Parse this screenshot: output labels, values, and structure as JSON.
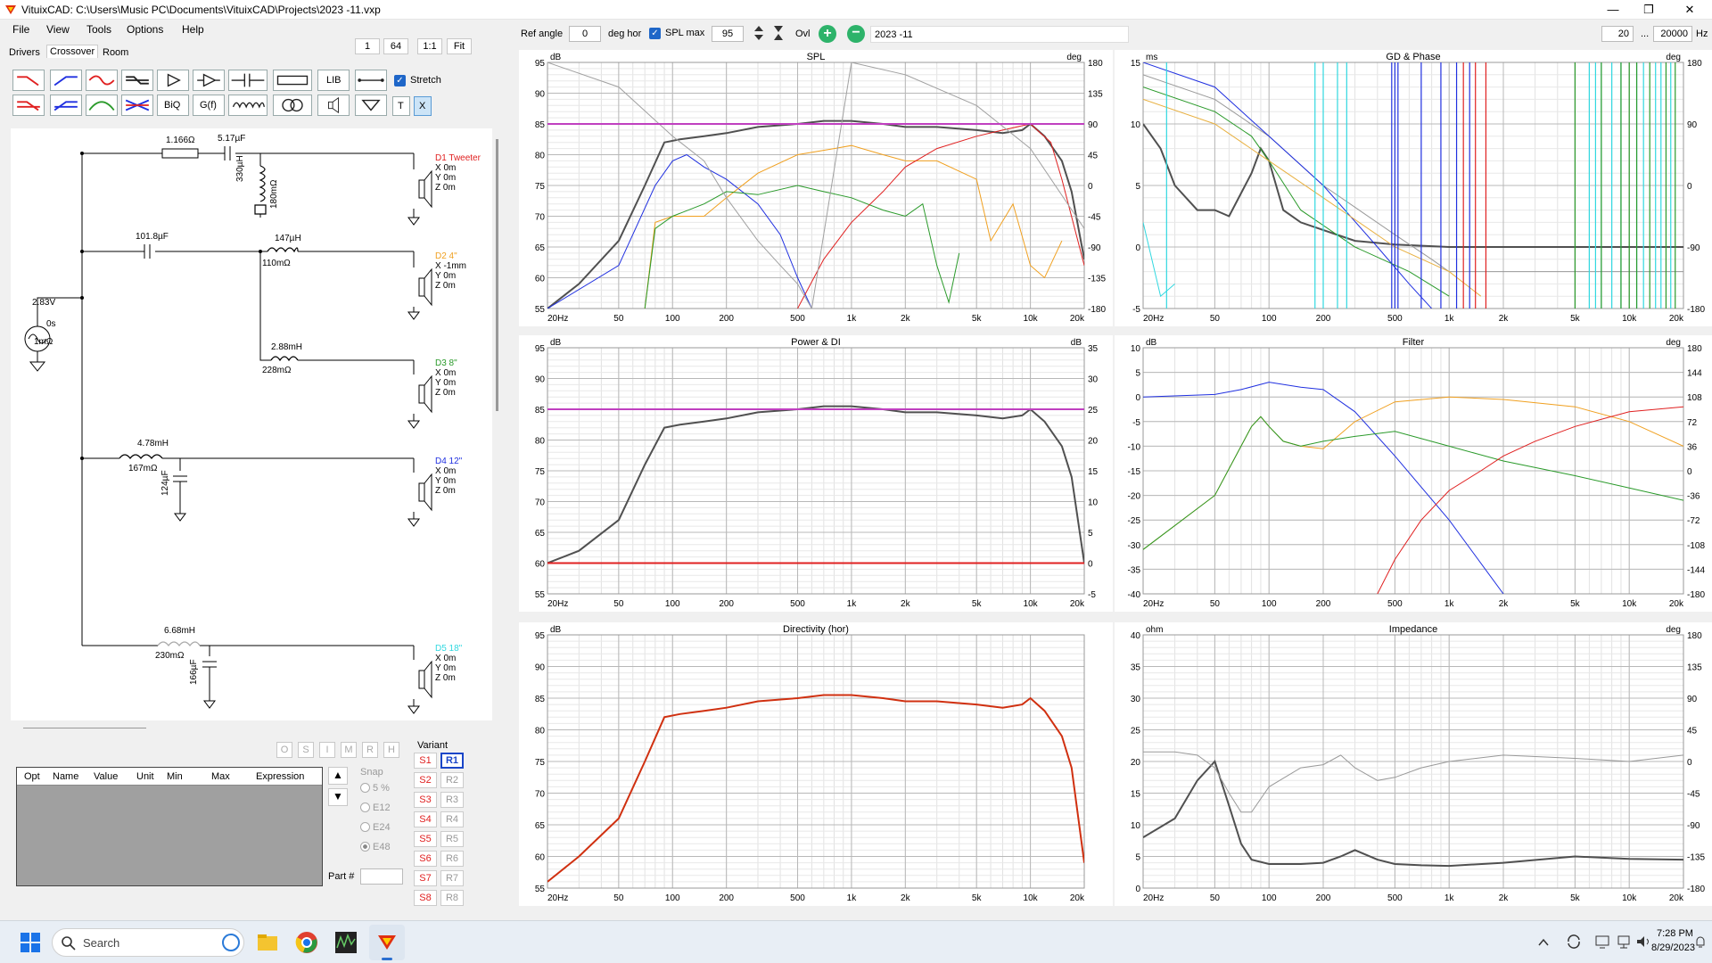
{
  "window": {
    "title": "VituixCAD: C:\\Users\\Music PC\\Documents\\VituixCAD\\Projects\\2023 -11.vxp",
    "minimize": "—",
    "maximize": "❐",
    "close": "✕"
  },
  "menu": [
    "File",
    "View",
    "Tools",
    "Options",
    "Help"
  ],
  "tabs": [
    "Drivers",
    "Crossover",
    "Room"
  ],
  "zoom_buttons": [
    "1",
    "64",
    "1:1",
    "Fit"
  ],
  "toolbar": {
    "lib": "LIB",
    "biq": "BiQ",
    "gf": "G(f)",
    "t": "T",
    "x": "X",
    "stretch": "Stretch"
  },
  "top": {
    "ref_angle_label": "Ref angle",
    "ref_angle_value": "0",
    "deg_hor": "deg hor",
    "spl_max_label": "SPL max",
    "spl_max_value": "95",
    "ovl": "Ovl",
    "variant_name": "2023 -11",
    "freq_min": "20",
    "freq_sep": "...",
    "freq_max": "20000",
    "freq_unit": "Hz"
  },
  "schematic": {
    "source": {
      "voltage": "2.83V",
      "delay": "0s",
      "resistance": "1mΩ"
    },
    "components": [
      {
        "id": "r1",
        "text": "1.166Ω"
      },
      {
        "id": "c1",
        "text": "5.17µF"
      },
      {
        "id": "l1",
        "text": "330µH"
      },
      {
        "id": "l1r",
        "text": "180mΩ"
      },
      {
        "id": "c2",
        "text": "101.8µF"
      },
      {
        "id": "l2",
        "text": "147µH"
      },
      {
        "id": "l2r",
        "text": "110mΩ"
      },
      {
        "id": "l3",
        "text": "2.88mH"
      },
      {
        "id": "l3r",
        "text": "228mΩ"
      },
      {
        "id": "l4",
        "text": "4.78mH"
      },
      {
        "id": "l4r",
        "text": "167mΩ"
      },
      {
        "id": "c4",
        "text": "124µF"
      },
      {
        "id": "l5",
        "text": "6.68mH"
      },
      {
        "id": "l5r",
        "text": "230mΩ"
      },
      {
        "id": "c5",
        "text": "166µF"
      }
    ],
    "drivers": [
      {
        "name": "D1 Tweeter",
        "color": "#e02020",
        "x": "X 0m",
        "y": "Y 0m",
        "z": "Z 0m"
      },
      {
        "name": "D2 4\"",
        "color": "#f0a020",
        "x": "X -1mm",
        "y": "Y 0m",
        "z": "Z 0m"
      },
      {
        "name": "D3 8\"",
        "color": "#2a9a2a",
        "x": "X 0m",
        "y": "Y 0m",
        "z": "Z 0m"
      },
      {
        "name": "D4 12\"",
        "color": "#2030e0",
        "x": "X 0m",
        "y": "Y 0m",
        "z": "Z 0m"
      },
      {
        "name": "D5 18\"",
        "color": "#30d8e0",
        "x": "X 0m",
        "y": "Y 0m",
        "z": "Z 0m"
      }
    ]
  },
  "param_table": {
    "flags": [
      "O",
      "S",
      "I",
      "M",
      "R",
      "H"
    ],
    "columns": [
      "Opt",
      "Name",
      "Value",
      "Unit",
      "Min",
      "Max",
      "Expression"
    ],
    "snap_label": "Snap",
    "snap_options": [
      "5 %",
      "E12",
      "E24",
      "E48"
    ],
    "part_label": "Part #",
    "up_arrow": "▲",
    "down_arrow": "▼"
  },
  "variants": {
    "label": "Variant",
    "s": [
      "S1",
      "S2",
      "S3",
      "S4",
      "S5",
      "S6",
      "S7",
      "S8"
    ],
    "r": [
      "R1",
      "R2",
      "R3",
      "R4",
      "R5",
      "R6",
      "R7",
      "R8"
    ],
    "active": "R1"
  },
  "charts": {
    "x_ticks": [
      "20Hz",
      "50",
      "100",
      "200",
      "500",
      "1k",
      "2k",
      "5k",
      "10k",
      "20k"
    ],
    "spl": {
      "title": "SPL",
      "left_unit": "dB",
      "right_unit": "deg",
      "left_ticks": [
        "95",
        "90",
        "85",
        "80",
        "75",
        "70",
        "65",
        "60",
        "55"
      ],
      "right_ticks": [
        "180",
        "135",
        "90",
        "45",
        "0",
        "-45",
        "-90",
        "-135",
        "-180"
      ]
    },
    "gd": {
      "title": "GD & Phase",
      "left_unit": "ms",
      "right_unit": "deg",
      "left_ticks": [
        "15",
        "10",
        "5",
        "0",
        "-5"
      ],
      "right_ticks": [
        "180",
        "90",
        "0",
        "-90",
        "-180"
      ]
    },
    "power": {
      "title": "Power & DI",
      "left_unit": "dB",
      "right_unit": "dB",
      "left_ticks": [
        "95",
        "90",
        "85",
        "80",
        "75",
        "70",
        "65",
        "60",
        "55"
      ],
      "right_ticks": [
        "35",
        "30",
        "25",
        "20",
        "15",
        "10",
        "5",
        "0",
        "-5"
      ]
    },
    "filter": {
      "title": "Filter",
      "left_unit": "dB",
      "right_unit": "deg",
      "left_ticks": [
        "10",
        "5",
        "0",
        "-5",
        "-10",
        "-15",
        "-20",
        "-25",
        "-30",
        "-35",
        "-40"
      ],
      "right_ticks": [
        "180",
        "144",
        "108",
        "72",
        "36",
        "0",
        "-36",
        "-72",
        "-108",
        "-144",
        "-180"
      ]
    },
    "directivity": {
      "title": "Directivity (hor)",
      "left_unit": "dB",
      "right_unit": "",
      "left_ticks": [
        "95",
        "90",
        "85",
        "80",
        "75",
        "70",
        "65",
        "60",
        "55"
      ],
      "right_ticks": []
    },
    "impedance": {
      "title": "Impedance",
      "left_unit": "ohm",
      "right_unit": "deg",
      "left_ticks": [
        "40",
        "35",
        "30",
        "25",
        "20",
        "15",
        "10",
        "5",
        "0"
      ],
      "right_ticks": [
        "180",
        "135",
        "90",
        "45",
        "0",
        "-45",
        "-90",
        "-135",
        "-180"
      ]
    }
  },
  "chart_data": [
    {
      "type": "line",
      "title": "SPL",
      "xlabel": "",
      "ylabel": "dB",
      "xlim": [
        20,
        20000
      ],
      "ylim": [
        55,
        95
      ],
      "x_scale": "log",
      "series": [
        {
          "color": "#505050",
          "x": [
            20,
            30,
            50,
            70,
            90,
            110,
            150,
            200,
            300,
            500,
            700,
            1000,
            1500,
            2000,
            3000,
            5000,
            7000,
            9000,
            10000,
            12000,
            15000,
            17000,
            20000
          ],
          "y": [
            55,
            59,
            66,
            75,
            82,
            82.5,
            83,
            83.5,
            84.5,
            85,
            85.5,
            85.5,
            85,
            84.5,
            84.5,
            84,
            83.5,
            84,
            85,
            83,
            79,
            74,
            63
          ]
        },
        {
          "color": "#2030e0",
          "x": [
            20,
            50,
            80,
            100,
            120,
            150,
            200,
            300,
            400,
            500,
            600
          ],
          "y": [
            55,
            62,
            75,
            79,
            80,
            78,
            76,
            72,
            67,
            60,
            55
          ]
        },
        {
          "color": "#f0a020",
          "x": [
            70,
            80,
            100,
            150,
            200,
            300,
            500,
            800,
            1000,
            1500,
            2000,
            3000,
            5000,
            6000,
            8000,
            10000,
            12000,
            15000
          ],
          "y": [
            55,
            69,
            70,
            70,
            73,
            77,
            80,
            81,
            81.5,
            80,
            79,
            79,
            76,
            66,
            72,
            62,
            60,
            66
          ]
        },
        {
          "color": "#2a9a2a",
          "x": [
            70,
            80,
            100,
            150,
            200,
            300,
            500,
            700,
            1000,
            1500,
            2000,
            2500,
            3000,
            3500,
            4000
          ],
          "y": [
            55,
            68,
            70,
            72,
            74,
            73.5,
            75,
            74,
            73,
            71,
            70,
            72,
            62,
            56,
            64
          ]
        },
        {
          "color": "#e02020",
          "x": [
            500,
            700,
            1000,
            1500,
            2000,
            3000,
            5000,
            7000,
            10000,
            13000,
            15000,
            20000
          ],
          "y": [
            55,
            63,
            69,
            74,
            78,
            81,
            83,
            84,
            85,
            82,
            76,
            62
          ]
        },
        {
          "color": "#a0a0a0",
          "x": [
            20,
            50,
            100,
            150,
            200,
            300,
            400,
            500,
            600,
            1000,
            2000,
            5000,
            10000,
            20000
          ],
          "y": [
            95,
            91,
            83,
            79,
            73,
            66,
            62,
            59,
            55,
            95,
            93,
            88,
            81,
            68
          ]
        },
        {
          "color": "#c040c0",
          "x": [
            20,
            20000
          ],
          "y": [
            85,
            85
          ]
        }
      ]
    },
    {
      "type": "line",
      "title": "Power & DI",
      "xlabel": "",
      "ylabel": "dB",
      "xlim": [
        20,
        20000
      ],
      "ylim": [
        55,
        95
      ],
      "x_scale": "log",
      "series": [
        {
          "color": "#505050",
          "x": [
            20,
            30,
            50,
            70,
            90,
            110,
            150,
            200,
            300,
            500,
            700,
            1000,
            1500,
            2000,
            3000,
            5000,
            7000,
            9000,
            10000,
            12000,
            15000,
            17000,
            20000
          ],
          "y": [
            60,
            62,
            67,
            76,
            82,
            82.5,
            83,
            83.5,
            84.5,
            85,
            85.5,
            85.5,
            85,
            84.5,
            84.5,
            84,
            83.5,
            84,
            85,
            83,
            79,
            74,
            60
          ]
        },
        {
          "color": "#c040c0",
          "x": [
            20,
            20000
          ],
          "y": [
            85,
            85
          ]
        },
        {
          "color": "#e02020",
          "x": [
            20,
            20000
          ],
          "y": [
            60,
            60
          ]
        }
      ]
    },
    {
      "type": "line",
      "title": "Filter",
      "xlabel": "",
      "ylabel": "dB",
      "xlim": [
        20,
        20000
      ],
      "ylim": [
        -40,
        10
      ],
      "x_scale": "log",
      "series": [
        {
          "color": "#2030e0",
          "x": [
            20,
            50,
            70,
            100,
            150,
            200,
            300,
            500,
            1000,
            2000
          ],
          "y": [
            0,
            0.5,
            1.5,
            3,
            2,
            1.5,
            -3,
            -12,
            -25,
            -40
          ]
        },
        {
          "color": "#f0a020",
          "x": [
            20,
            50,
            80,
            90,
            100,
            120,
            150,
            200,
            300,
            500,
            1000,
            2000,
            5000,
            10000,
            20000
          ],
          "y": [
            -31,
            -20,
            -6,
            -4,
            -6,
            -9,
            -10,
            -10.5,
            -5,
            -1,
            0,
            -0.5,
            -2,
            -5,
            -10
          ]
        },
        {
          "color": "#2a9a2a",
          "x": [
            20,
            50,
            80,
            90,
            100,
            120,
            150,
            200,
            300,
            500,
            1000,
            2000,
            5000,
            10000,
            20000
          ],
          "y": [
            -31,
            -20,
            -6,
            -4,
            -6,
            -9,
            -10,
            -9,
            -8,
            -7,
            -10,
            -13,
            -16,
            -18.5,
            -21
          ]
        },
        {
          "color": "#e02020",
          "x": [
            400,
            500,
            700,
            1000,
            1500,
            2000,
            3000,
            5000,
            10000,
            20000
          ],
          "y": [
            -40,
            -33,
            -25,
            -19,
            -15,
            -12,
            -9,
            -6,
            -3,
            -2
          ]
        }
      ]
    },
    {
      "type": "line",
      "title": "Directivity (hor)",
      "xlabel": "",
      "ylabel": "dB",
      "xlim": [
        20,
        20000
      ],
      "ylim": [
        55,
        95
      ],
      "x_scale": "log",
      "series": [
        {
          "color": "#d03010",
          "x": [
            20,
            30,
            50,
            70,
            90,
            110,
            150,
            200,
            300,
            500,
            700,
            1000,
            1500,
            2000,
            3000,
            5000,
            7000,
            9000,
            10000,
            12000,
            15000,
            17000,
            20000
          ],
          "y": [
            56,
            60,
            66,
            75,
            82,
            82.5,
            83,
            83.5,
            84.5,
            85,
            85.5,
            85.5,
            85,
            84.5,
            84.5,
            84,
            83.5,
            84,
            85,
            83,
            79,
            74,
            59
          ]
        }
      ]
    },
    {
      "type": "line",
      "title": "Impedance",
      "xlabel": "",
      "ylabel": "ohm",
      "xlim": [
        20,
        20000
      ],
      "ylim": [
        0,
        40
      ],
      "x_scale": "log",
      "series": [
        {
          "color": "#505050",
          "x": [
            20,
            30,
            40,
            50,
            60,
            70,
            80,
            100,
            150,
            200,
            250,
            300,
            400,
            500,
            700,
            1000,
            2000,
            5000,
            10000,
            20000
          ],
          "y": [
            8,
            11,
            17,
            20,
            13,
            7,
            4.5,
            3.8,
            3.8,
            4,
            5,
            6,
            4.5,
            3.8,
            3.6,
            3.5,
            4,
            5,
            4.6,
            4.5
          ]
        },
        {
          "color": "#999999",
          "x": [
            20,
            30,
            40,
            50,
            60,
            70,
            80,
            100,
            150,
            200,
            250,
            300,
            400,
            500,
            700,
            1000,
            2000,
            5000,
            10000,
            20000
          ],
          "y": [
            21.5,
            21.5,
            21,
            19,
            15,
            12,
            12,
            16,
            19,
            19.5,
            21,
            19,
            17,
            17.5,
            19,
            20,
            21,
            20.5,
            20,
            21
          ]
        }
      ]
    }
  ],
  "taskbar": {
    "search": "Search",
    "time": "7:28 PM",
    "date": "8/29/2023"
  }
}
